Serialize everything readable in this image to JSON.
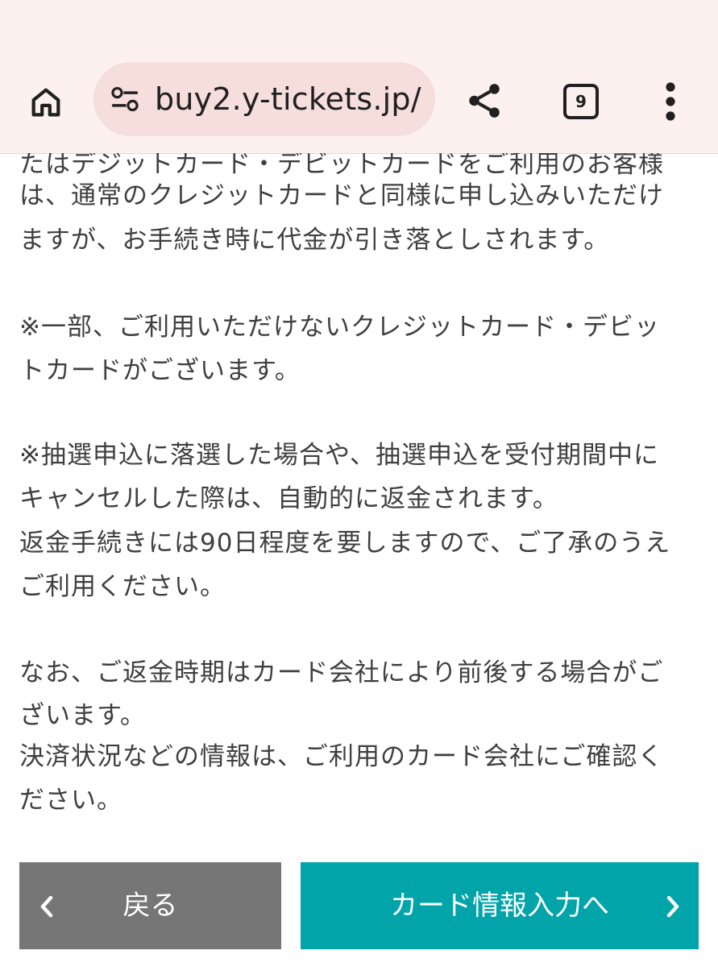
{
  "browser": {
    "url": "buy2.y-tickets.jp/",
    "tab_count": "9"
  },
  "content": {
    "lines": [
      "たはデジットカード・デビットカードをご利用のお客様",
      "は、通常のクレジットカードと同様に申し込みいただけ",
      "ますが、お手続き時に代金が引き落としされます。",
      "※一部、ご利用いただけないクレジットカード・デビッ",
      "トカードがございます。",
      "※抽選申込に落選した場合や、抽選申込を受付期間中に",
      "キャンセルした際は、自動的に返金されます。",
      "返金手続きには90日程度を要しますので、ご了承のうえ",
      "ご利用ください。",
      "なお、ご返金時期はカード会社により前後する場合がご",
      "ざいます。",
      "決済状況などの情報は、ご利用のカード会社にご確認く",
      "ださい。"
    ]
  },
  "footer": {
    "back_label": "戻る",
    "next_label": "カード情報入力へ"
  },
  "colors": {
    "browser_bar": "#fdf1ef",
    "url_pill": "#f5dedb",
    "back_button": "#767676",
    "next_button": "#00a4a9"
  }
}
